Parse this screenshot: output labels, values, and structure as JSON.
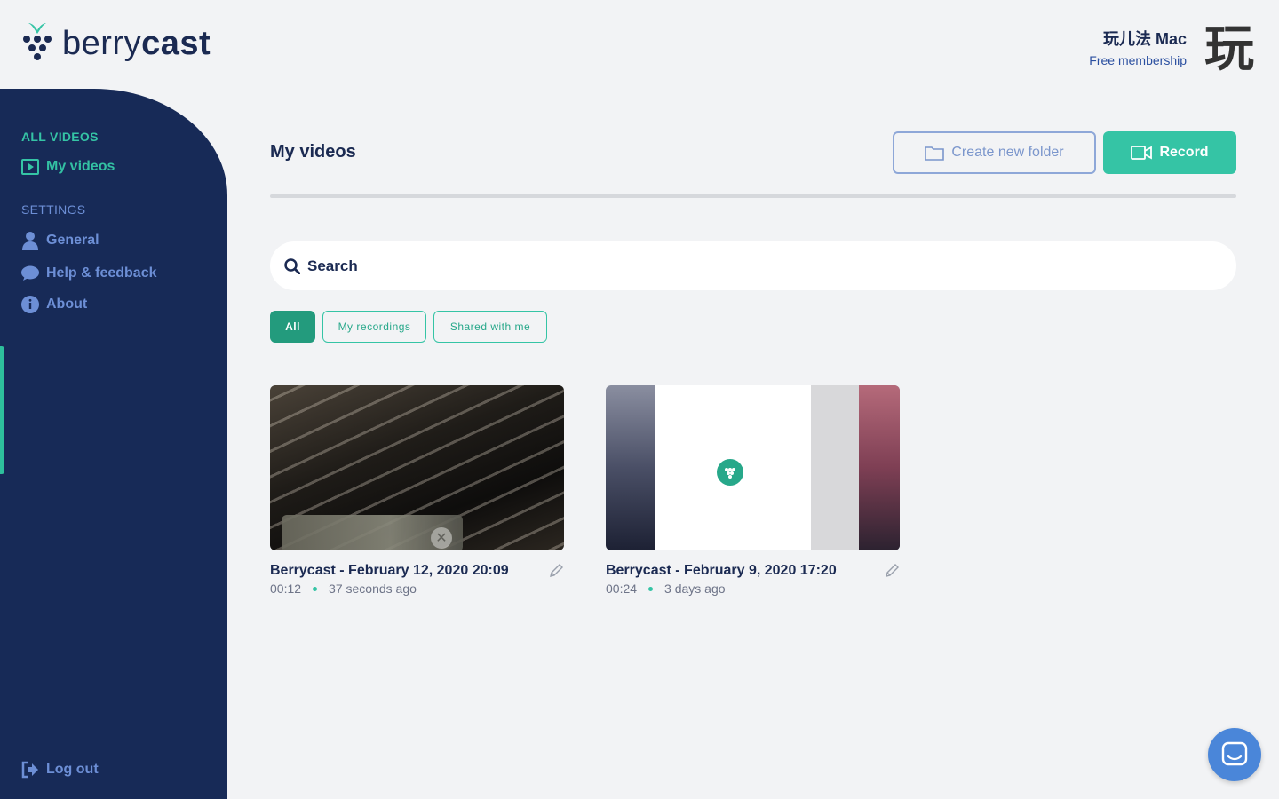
{
  "brand": {
    "logo_regular": "berry",
    "logo_bold": "cast",
    "accent": "#35c4a5",
    "navy": "#172a57"
  },
  "user": {
    "name": "玩儿法 Mac",
    "plan": "Free membership",
    "avatar_glyph": "玩"
  },
  "sidebar": {
    "section_all": "ALL VIDEOS",
    "my_videos": "My videos",
    "section_settings": "SETTINGS",
    "general": "General",
    "help": "Help & feedback",
    "about": "About",
    "logout": "Log out"
  },
  "main": {
    "title": "My videos",
    "create_folder": "Create new folder",
    "record": "Record",
    "search_placeholder": "Search",
    "filters": [
      "All",
      "My recordings",
      "Shared with me"
    ],
    "videos": [
      {
        "title": "Berrycast - February 12, 2020 20:09",
        "duration": "00:12",
        "age": "37 seconds ago"
      },
      {
        "title": "Berrycast - February 9, 2020 17:20",
        "duration": "00:24",
        "age": "3 days ago"
      }
    ]
  }
}
